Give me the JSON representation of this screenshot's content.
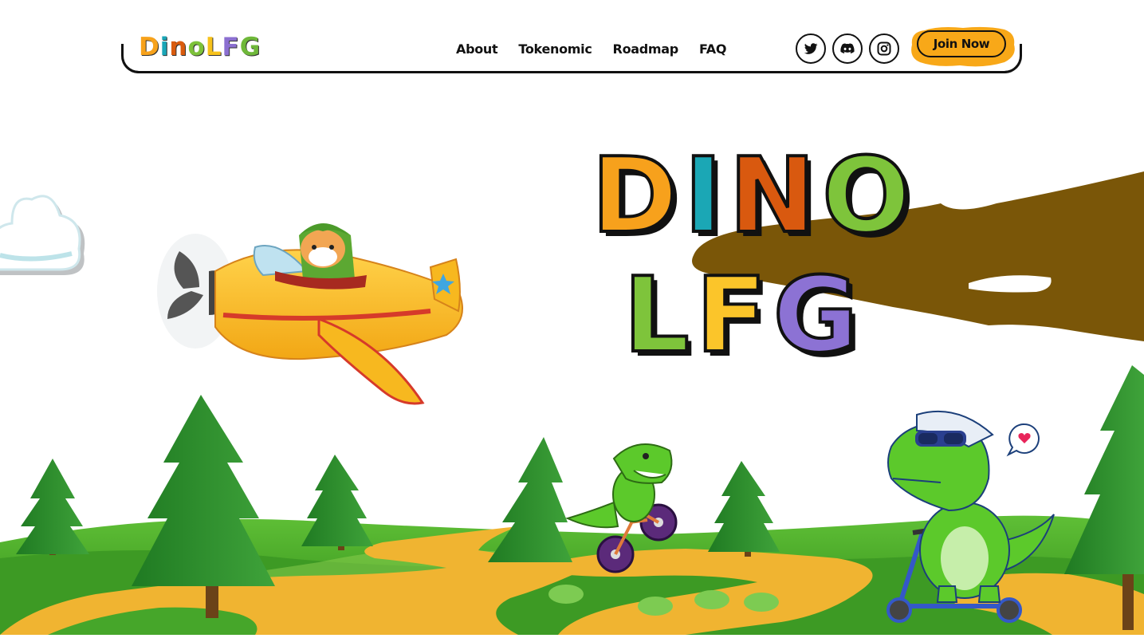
{
  "header": {
    "logo_letters": [
      {
        "char": "D",
        "color": "#f7a21b"
      },
      {
        "char": "i",
        "color": "#1aa6b7"
      },
      {
        "char": "n",
        "color": "#d95b0e"
      },
      {
        "char": "o",
        "color": "#7dc23a"
      },
      {
        "char": "L",
        "color": "#f7c21b"
      },
      {
        "char": "F",
        "color": "#8b6fd0"
      },
      {
        "char": "G",
        "color": "#6fb83a"
      }
    ],
    "nav": [
      {
        "label": "About"
      },
      {
        "label": "Tokenomic"
      },
      {
        "label": "Roadmap"
      },
      {
        "label": "FAQ"
      }
    ],
    "socials": [
      {
        "name": "twitter-icon"
      },
      {
        "name": "discord-icon"
      },
      {
        "name": "instagram-icon"
      }
    ],
    "join_label": "Join Now",
    "join_color": "#f8a818"
  },
  "hero": {
    "line1": [
      {
        "char": "D",
        "color": "#f7a11c"
      },
      {
        "char": "I",
        "color": "#1ba7b5"
      },
      {
        "char": "N",
        "color": "#d9590f"
      },
      {
        "char": "O",
        "color": "#7ec43b"
      }
    ],
    "line2": [
      {
        "char": "L",
        "color": "#7ec43b"
      },
      {
        "char": "F",
        "color": "#fbc52a"
      },
      {
        "char": "G",
        "color": "#8c72d4"
      }
    ],
    "mud_color": "#7a5608",
    "heart_icon": "heart-icon"
  },
  "colors": {
    "grass_dark": "#3f9b1c",
    "grass_light": "#6cc43a",
    "path": "#f0b431",
    "tree": "#2d8a2a",
    "plane": "#f7b81f",
    "dino": "#5cc92b"
  }
}
